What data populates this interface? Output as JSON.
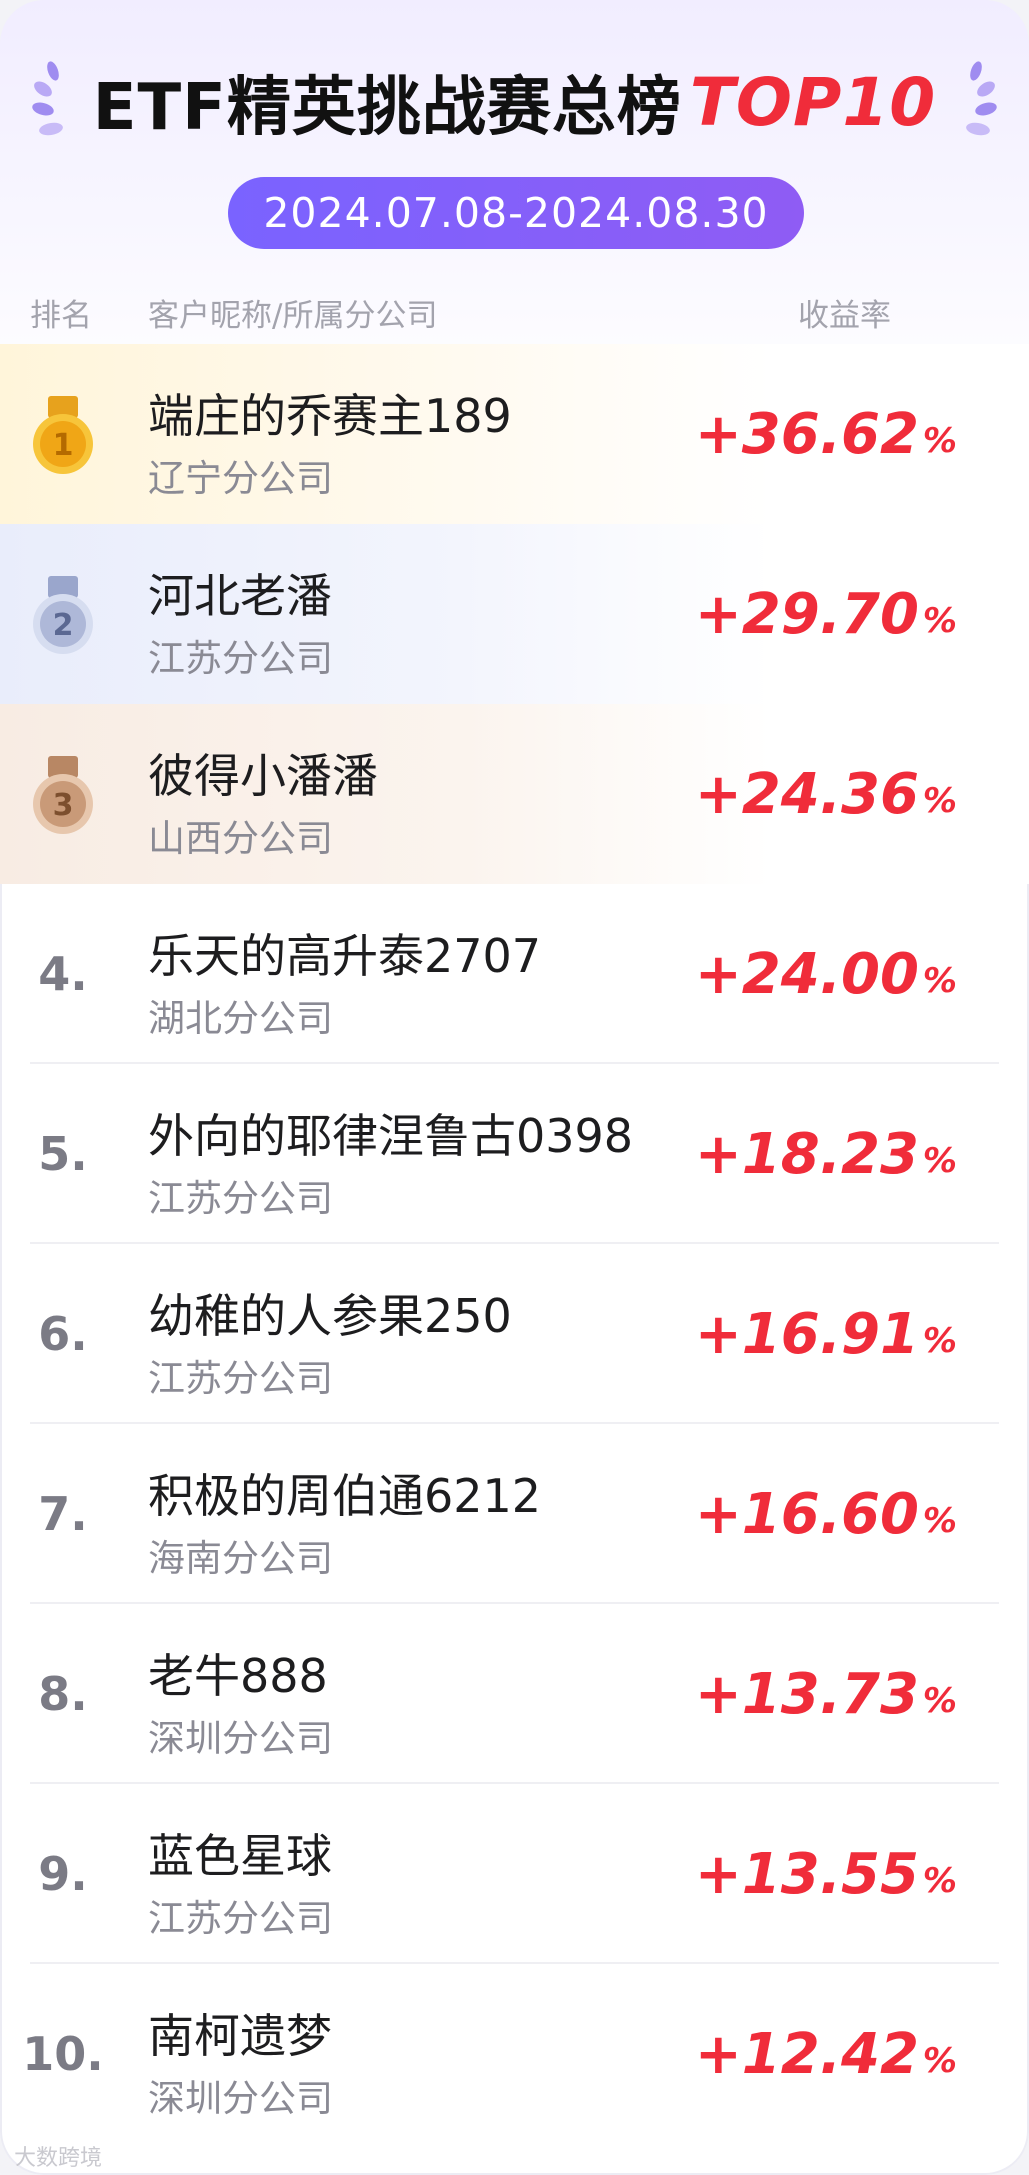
{
  "header": {
    "title": "ETF精英挑战赛总榜",
    "title_highlight": "TOP10",
    "date_range": "2024.07.08-2024.08.30"
  },
  "columns": {
    "rank": "排名",
    "nickname": "客户昵称/所属分公司",
    "return": "收益率"
  },
  "colors": {
    "accent": "#7a63ff",
    "positive": "#f02c3a",
    "gold": "#f5b51c",
    "silver": "#aeb8d8",
    "bronze": "#c99a78"
  },
  "rows": [
    {
      "rank": "1",
      "medal": "gold",
      "name": "端庄的乔赛主189",
      "branch": "辽宁分公司",
      "return": "+36.62",
      "unit": "%"
    },
    {
      "rank": "2",
      "medal": "silver",
      "name": "河北老潘",
      "branch": "江苏分公司",
      "return": "+29.70",
      "unit": "%"
    },
    {
      "rank": "3",
      "medal": "bronze",
      "name": "彼得小潘潘",
      "branch": "山西分公司",
      "return": "+24.36",
      "unit": "%"
    },
    {
      "rank": "4.",
      "name": "乐天的高升泰2707",
      "branch": "湖北分公司",
      "return": "+24.00",
      "unit": "%"
    },
    {
      "rank": "5.",
      "name": "外向的耶律涅鲁古0398",
      "branch": "江苏分公司",
      "return": "+18.23",
      "unit": "%"
    },
    {
      "rank": "6.",
      "name": "幼稚的人参果250",
      "branch": "江苏分公司",
      "return": "+16.91",
      "unit": "%"
    },
    {
      "rank": "7.",
      "name": "积极的周伯通6212",
      "branch": "海南分公司",
      "return": "+16.60",
      "unit": "%"
    },
    {
      "rank": "8.",
      "name": "老牛888",
      "branch": "深圳分公司",
      "return": "+13.73",
      "unit": "%"
    },
    {
      "rank": "9.",
      "name": "蓝色星球",
      "branch": "江苏分公司",
      "return": "+13.55",
      "unit": "%"
    },
    {
      "rank": "10.",
      "name": "南柯遗梦",
      "branch": "深圳分公司",
      "return": "+12.42",
      "unit": "%"
    }
  ],
  "watermark": "大数跨境"
}
